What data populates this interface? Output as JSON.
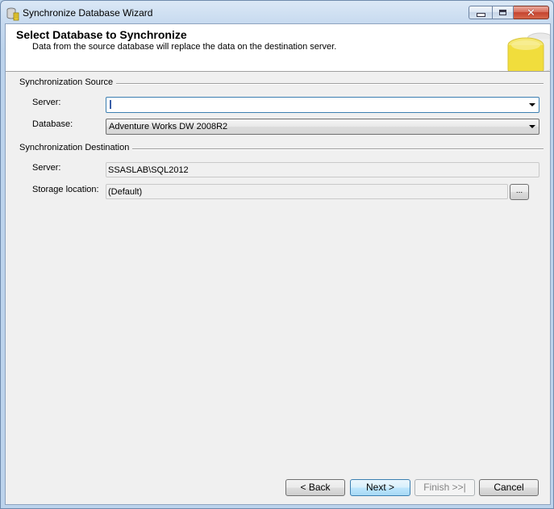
{
  "window": {
    "title": "Synchronize Database Wizard",
    "close_glyph": "✕"
  },
  "header": {
    "title": "Select Database to Synchronize",
    "subtitle": "Data from the source database will replace the data on the destination server."
  },
  "source": {
    "group_label": "Synchronization Source",
    "server_label": "Server:",
    "server_value": "",
    "database_label": "Database:",
    "database_value": "Adventure Works DW 2008R2"
  },
  "destination": {
    "group_label": "Synchronization Destination",
    "server_label": "Server:",
    "server_value": "SSASLAB\\SQL2012",
    "storage_label": "Storage location:",
    "storage_value": "(Default)",
    "browse_label": "..."
  },
  "buttons": {
    "back": "< Back",
    "next": "Next >",
    "finish": "Finish >>|",
    "cancel": "Cancel"
  },
  "colors": {
    "accent": "#3c7fb1",
    "db_icon": "#f1dd3c"
  }
}
